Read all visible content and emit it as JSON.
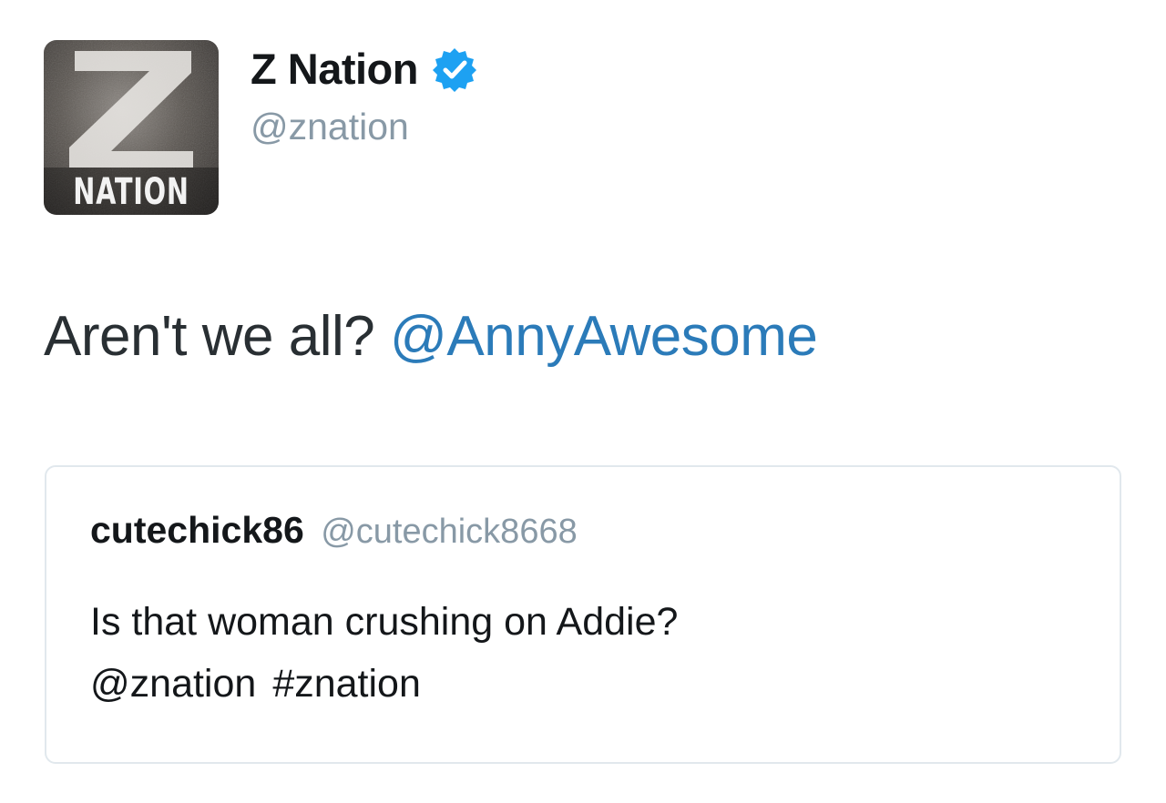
{
  "author": {
    "display_name": "Z Nation",
    "handle": "@znation",
    "verified": true,
    "avatar_text": "NATION",
    "avatar_letter": "Z"
  },
  "tweet": {
    "text": "Aren't we all?",
    "mention": "@AnnyAwesome"
  },
  "quoted_tweet": {
    "display_name": "cutechick86",
    "handle": "@cutechick8668",
    "line1": "Is that woman crushing on Addie?",
    "mention": "@znation",
    "hashtag": "#znation"
  },
  "colors": {
    "link": "#2b7bb9",
    "verified": "#1da1f2",
    "muted": "#8899a6",
    "text": "#14171a",
    "border": "#e1e8ed"
  }
}
